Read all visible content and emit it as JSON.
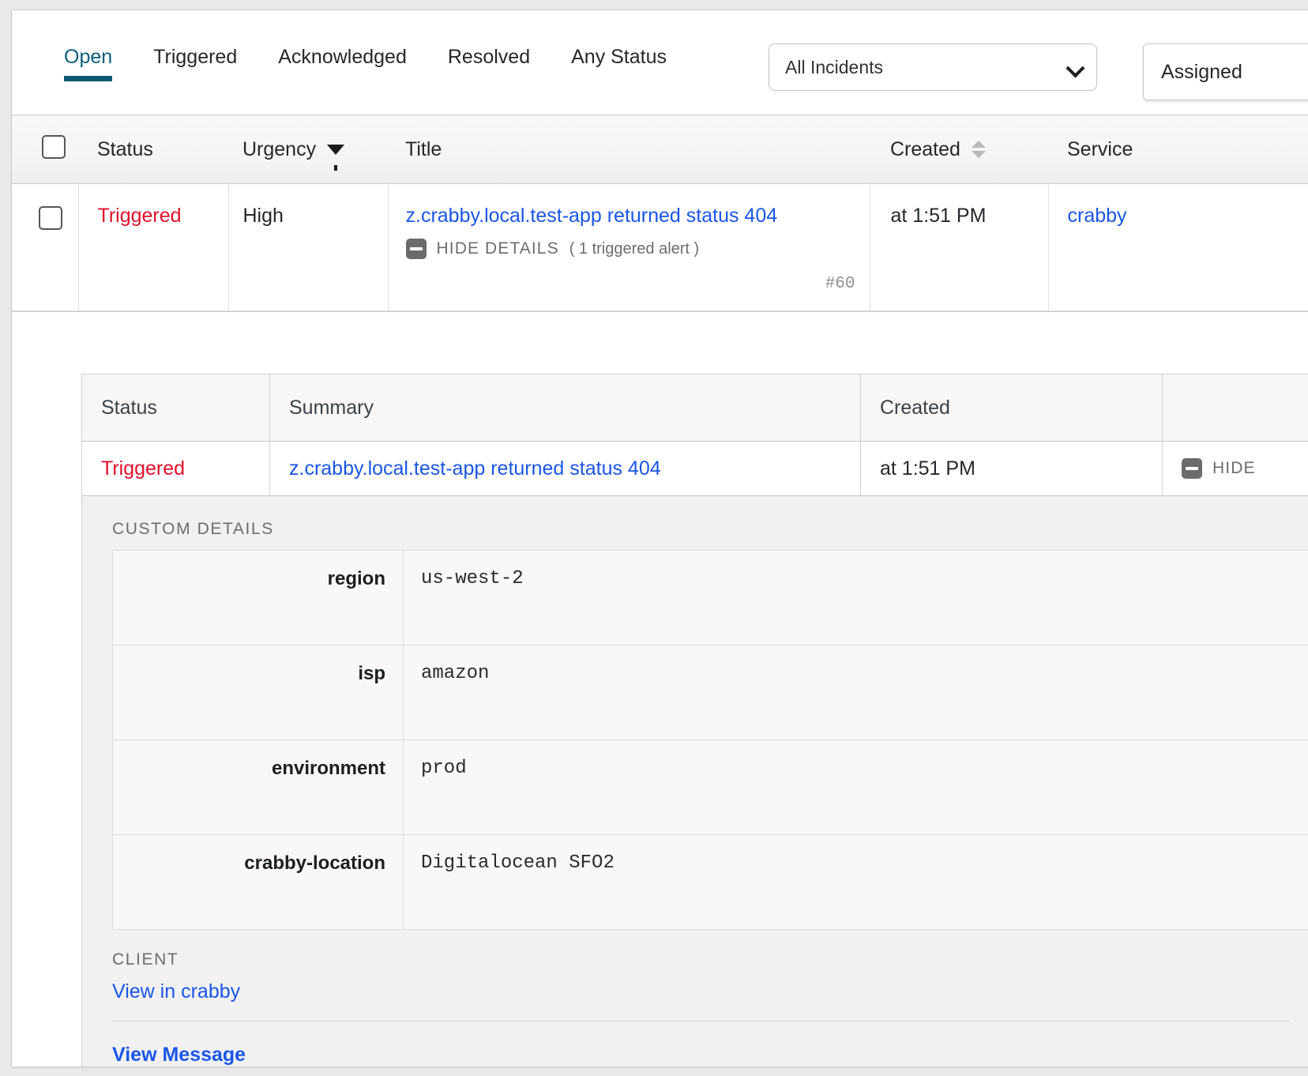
{
  "toolbar": {
    "tabs": [
      {
        "label": "Open",
        "active": true
      },
      {
        "label": "Triggered",
        "active": false
      },
      {
        "label": "Acknowledged",
        "active": false
      },
      {
        "label": "Resolved",
        "active": false
      },
      {
        "label": "Any Status",
        "active": false
      }
    ],
    "incident_filter_value": "All Incidents",
    "assigned_button_label": "Assigned"
  },
  "table": {
    "headers": {
      "status": "Status",
      "urgency": "Urgency",
      "title": "Title",
      "created": "Created",
      "service": "Service"
    },
    "rows": [
      {
        "status": "Triggered",
        "urgency": "High",
        "title": "z.crabby.local.test-app returned status 404",
        "details_toggle_label": "HIDE DETAILS",
        "details_count": "( 1 triggered alert )",
        "incident_number": "#60",
        "created": "at 1:51 PM",
        "service": "crabby"
      }
    ]
  },
  "expanded": {
    "alert_headers": {
      "status": "Status",
      "summary": "Summary",
      "created": "Created",
      "hide": ""
    },
    "alert_row": {
      "status": "Triggered",
      "summary": "z.crabby.local.test-app returned status 404",
      "created": "at 1:51 PM",
      "hide_label": "HIDE"
    },
    "custom_details_label": "CUSTOM DETAILS",
    "custom_details": [
      {
        "key": "region",
        "value": "us-west-2"
      },
      {
        "key": "isp",
        "value": "amazon"
      },
      {
        "key": "environment",
        "value": "prod"
      },
      {
        "key": "crabby-location",
        "value": "Digitalocean SFO2"
      }
    ],
    "client_label": "CLIENT",
    "client_link": "View in crabby",
    "view_message_label": "View Message"
  },
  "colors": {
    "accent_tab": "#0b5971",
    "link": "#1a56e8",
    "status_triggered": "#e1102b",
    "header_bg": "#f4f4f4",
    "panel_bg": "#f1f1f1"
  }
}
